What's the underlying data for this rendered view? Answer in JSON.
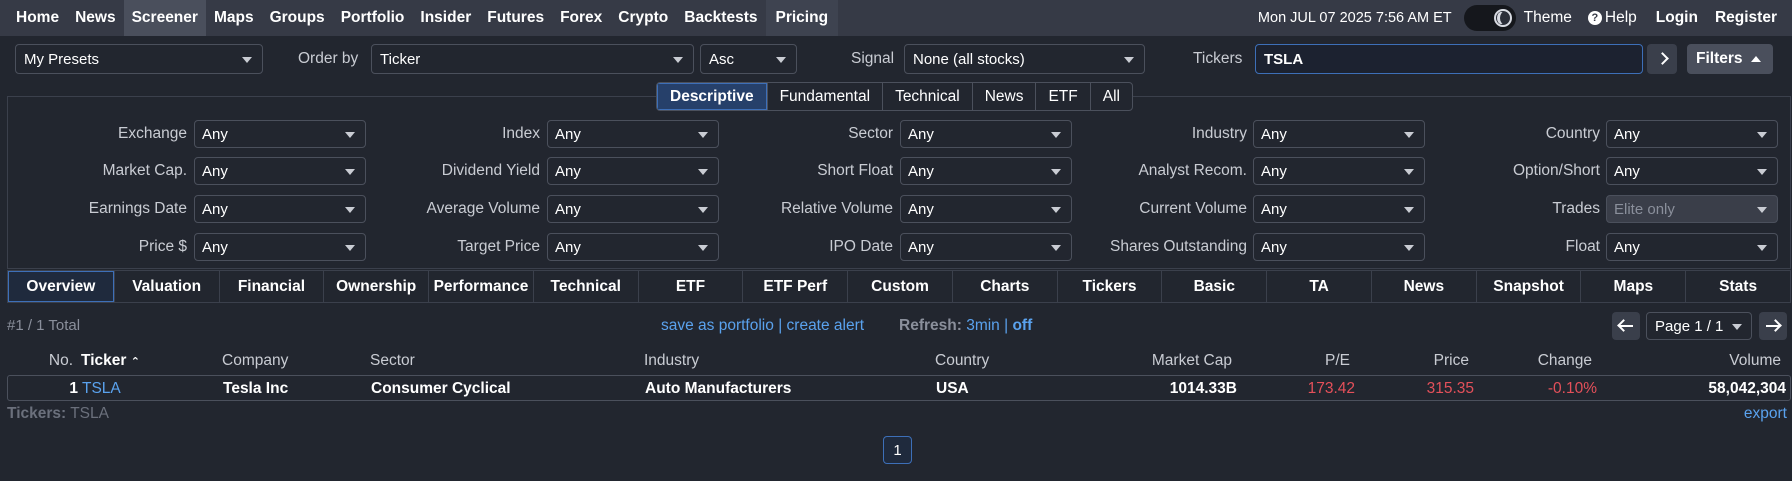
{
  "nav": {
    "items": [
      "Home",
      "News",
      "Screener",
      "Maps",
      "Groups",
      "Portfolio",
      "Insider",
      "Futures",
      "Forex",
      "Crypto",
      "Backtests",
      "Pricing"
    ],
    "active": "Screener",
    "datetime": "Mon JUL 07 2025 7:56 AM ET",
    "theme_label": "Theme",
    "help_label": "Help",
    "login_label": "Login",
    "register_label": "Register"
  },
  "controls": {
    "presets": "My Presets",
    "order_by_label": "Order by",
    "order_by": "Ticker",
    "order_dir": "Asc",
    "signal_label": "Signal",
    "signal": "None (all stocks)",
    "tickers_label": "Tickers",
    "tickers_value": "TSLA",
    "filters_label": "Filters"
  },
  "filter_tabs": [
    "Descriptive",
    "Fundamental",
    "Technical",
    "News",
    "ETF",
    "All"
  ],
  "filter_tab_active": "Descriptive",
  "filters": [
    {
      "label": "Exchange",
      "value": "Any"
    },
    {
      "label": "Index",
      "value": "Any"
    },
    {
      "label": "Sector",
      "value": "Any"
    },
    {
      "label": "Industry",
      "value": "Any"
    },
    {
      "label": "Country",
      "value": "Any"
    },
    {
      "label": "Market Cap.",
      "value": "Any"
    },
    {
      "label": "Dividend Yield",
      "value": "Any"
    },
    {
      "label": "Short Float",
      "value": "Any"
    },
    {
      "label": "Analyst Recom.",
      "value": "Any"
    },
    {
      "label": "Option/Short",
      "value": "Any"
    },
    {
      "label": "Earnings Date",
      "value": "Any"
    },
    {
      "label": "Average Volume",
      "value": "Any"
    },
    {
      "label": "Relative Volume",
      "value": "Any"
    },
    {
      "label": "Current Volume",
      "value": "Any"
    },
    {
      "label": "Trades",
      "value": "Elite only"
    },
    {
      "label": "Price $",
      "value": "Any"
    },
    {
      "label": "Target Price",
      "value": "Any"
    },
    {
      "label": "IPO Date",
      "value": "Any"
    },
    {
      "label": "Shares Outstanding",
      "value": "Any"
    },
    {
      "label": "Float",
      "value": "Any"
    }
  ],
  "view_tabs": [
    "Overview",
    "Valuation",
    "Financial",
    "Ownership",
    "Performance",
    "Technical",
    "ETF",
    "ETF Perf",
    "Custom",
    "Charts",
    "Tickers",
    "Basic",
    "TA",
    "News",
    "Snapshot",
    "Maps",
    "Stats"
  ],
  "view_tab_active": "Overview",
  "info": {
    "total": "#1 / 1 Total",
    "save_portfolio": "save as portfolio",
    "create_alert": "create alert",
    "refresh_label": "Refresh:",
    "refresh_interval": "3min",
    "refresh_off": "off",
    "page": "Page 1 / 1"
  },
  "table": {
    "headers": [
      "No.",
      "Ticker",
      "Company",
      "Sector",
      "Industry",
      "Country",
      "Market Cap",
      "P/E",
      "Price",
      "Change",
      "Volume"
    ],
    "rows": [
      [
        "1",
        "TSLA",
        "Tesla Inc",
        "Consumer Cyclical",
        "Auto Manufacturers",
        "USA",
        "1014.33B",
        "173.42",
        "315.35",
        "-0.10%",
        "58,042,304"
      ]
    ]
  },
  "footer": {
    "tickers_label": "Tickers:",
    "tickers_value": "TSLA",
    "export": "export",
    "page_number": "1"
  },
  "colors": {
    "background": "#22262f",
    "nav_background": "#363a46",
    "link": "#5aa2ee",
    "negative": "#e4505a",
    "active_border": "#3d6fb8"
  }
}
